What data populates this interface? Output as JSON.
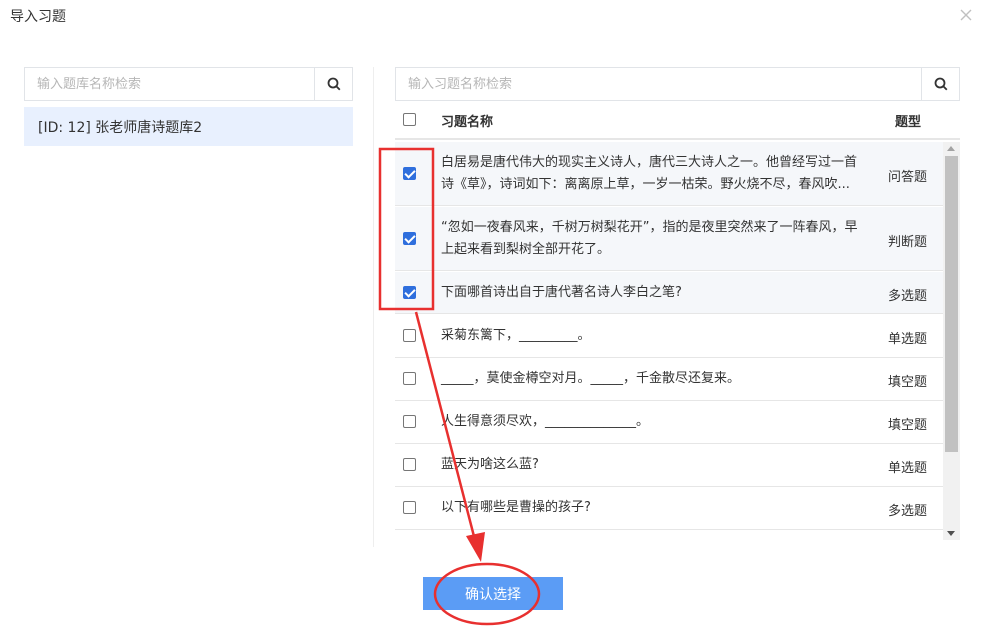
{
  "dialog": {
    "title": "导入习题"
  },
  "left": {
    "search_placeholder": "输入题库名称检索",
    "banks": [
      {
        "label": "[ID: 12] 张老师唐诗题库2"
      }
    ]
  },
  "right": {
    "search_placeholder": "输入习题名称检索",
    "header": {
      "name": "习题名称",
      "type": "题型"
    },
    "rows": [
      {
        "name": "白居易是唐代伟大的现实主义诗人，唐代三大诗人之一。他曾经写过一首诗《草》，诗词如下：离离原上草，一岁一枯荣。野火烧不尽，春风吹...",
        "type": "问答题",
        "checked": true
      },
      {
        "name": "“忽如一夜春风来，千树万树梨花开”，指的是夜里突然来了一阵春风，早上起来看到梨树全部开花了。",
        "type": "判断题",
        "checked": true
      },
      {
        "name": "下面哪首诗出自于唐代著名诗人李白之笔?",
        "type": "多选题",
        "checked": true
      },
      {
        "name": "采菊东篱下，_________。",
        "type": "单选题",
        "checked": false
      },
      {
        "name": "_____，莫使金樽空对月。_____，千金散尽还复来。",
        "type": "填空题",
        "checked": false
      },
      {
        "name": "人生得意须尽欢，______________。",
        "type": "填空题",
        "checked": false
      },
      {
        "name": "蓝天为啥这么蓝?",
        "type": "单选题",
        "checked": false
      },
      {
        "name": "以下有哪些是曹操的孩子?",
        "type": "多选题",
        "checked": false
      }
    ]
  },
  "footer": {
    "confirm_label": "确认选择"
  },
  "colors": {
    "accent": "#2f6fdd",
    "button": "#5b9cf5",
    "annotation": "#e8302f",
    "selected_bank_bg": "#e8f0fe"
  }
}
